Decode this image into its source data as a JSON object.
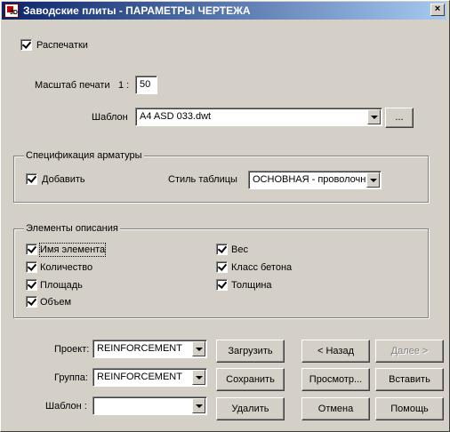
{
  "window": {
    "title": "Заводские плиты - ПАРАМЕТРЫ ЧЕРТЕЖА",
    "close_symbol": "×"
  },
  "print": {
    "checkbox_label": "Распечатки",
    "checked": true,
    "scale_label": "Масштаб печати",
    "scale_prefix": "1 :",
    "scale_value": "50",
    "template_label": "Шаблон",
    "template_value": "A4 ASD 033.dwt",
    "browse_label": "..."
  },
  "rebar_spec": {
    "group_title": "Спецификация арматуры",
    "add_label": "Добавить",
    "add_checked": true,
    "table_style_label": "Стиль таблицы",
    "table_style_value": "ОСНОВНАЯ - проволочн"
  },
  "description": {
    "group_title": "Элементы описания",
    "items_left": [
      {
        "label": "Имя элемента",
        "checked": true
      },
      {
        "label": "Количество",
        "checked": true
      },
      {
        "label": "Площадь",
        "checked": true
      },
      {
        "label": "Объем",
        "checked": true
      }
    ],
    "items_right": [
      {
        "label": "Вес",
        "checked": true
      },
      {
        "label": "Класс бетона",
        "checked": true
      },
      {
        "label": "Толщина",
        "checked": true
      }
    ]
  },
  "footer": {
    "project_label": "Проект:",
    "project_value": "REINFORCEMENT",
    "group_label": "Группа:",
    "group_value": "REINFORCEMENT",
    "template_label": "Шаблон :",
    "template_value": "",
    "load_button": "Загрузить",
    "save_button": "Сохранить",
    "delete_button": "Удалить",
    "back_button": "< Назад",
    "next_button": "Далее >",
    "preview_button": "Просмотр...",
    "insert_button": "Вставить",
    "cancel_button": "Отмена",
    "help_button": "Помощь"
  },
  "colors": {
    "face": "#d4d0c8",
    "title_start": "#0a246a",
    "title_end": "#a6caf0"
  }
}
